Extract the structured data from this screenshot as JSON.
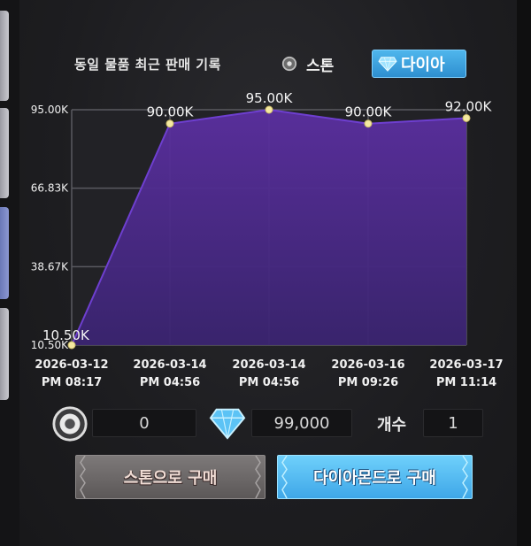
{
  "window": {
    "title": "동일 물품 최근 판매 기록"
  },
  "currency_toggle": {
    "stone_label": "스톤",
    "diamond_label": "다이아",
    "selected": "diamond"
  },
  "chart_data": {
    "type": "area",
    "title": "",
    "x": [
      "2026-03-12 PM 08:17",
      "2026-03-14 PM 04:56",
      "2026-03-14 PM 04:56",
      "2026-03-16 PM 09:26",
      "2026-03-17 PM 11:14"
    ],
    "x_dates": [
      "2026-03-12",
      "2026-03-14",
      "2026-03-14",
      "2026-03-16",
      "2026-03-17"
    ],
    "x_times": [
      "PM 08:17",
      "PM 04:56",
      "PM 04:56",
      "PM 09:26",
      "PM 11:14"
    ],
    "values": [
      10500,
      90000,
      95000,
      90000,
      92000
    ],
    "value_labels": [
      "10.50K",
      "90.00K",
      "95.00K",
      "90.00K",
      "92.00K"
    ],
    "ylim": [
      10500,
      95000
    ],
    "yticks": [
      10500,
      38670,
      66830,
      95000
    ],
    "ytick_labels": [
      "10.50K",
      "38.67K",
      "66.83K",
      "95.00K"
    ],
    "grid": true,
    "colors": {
      "fill_top": "#5b2fa0",
      "fill_bottom": "#3a2470",
      "line": "#6e3fd0",
      "marker": "#f4e9a0"
    }
  },
  "purchase": {
    "stone_amount": "0",
    "diamond_amount": "99,000",
    "count_label": "개수",
    "count_value": "1",
    "buy_stone_label": "스톤으로 구매",
    "buy_diamond_label": "다이아몬드로 구매"
  },
  "icons": {
    "stone": "stone-icon",
    "diamond": "diamond-icon"
  }
}
